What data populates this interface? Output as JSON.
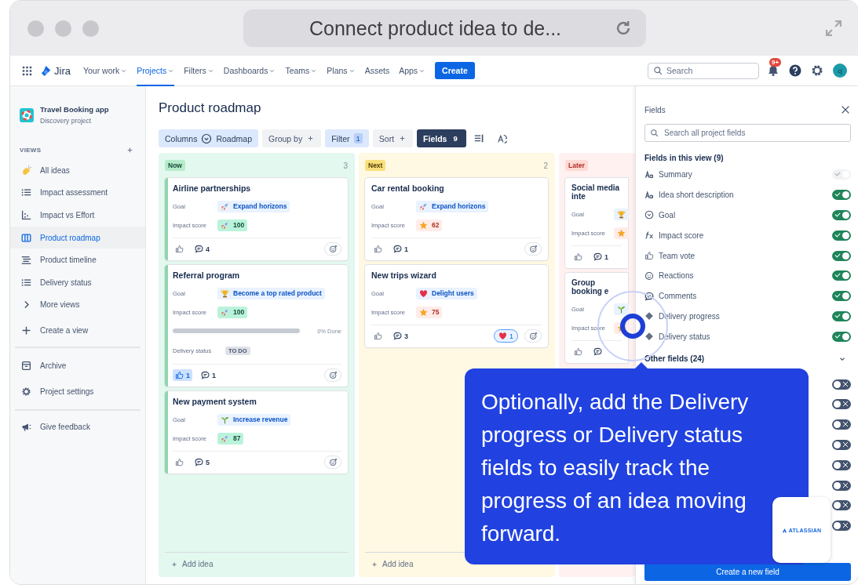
{
  "browser": {
    "address": "Connect product idea to de..."
  },
  "nav": {
    "product": "Jira",
    "items": [
      {
        "label": "Your work",
        "dropdown": true,
        "selected": false
      },
      {
        "label": "Projects",
        "dropdown": true,
        "selected": true
      },
      {
        "label": "Filters",
        "dropdown": true,
        "selected": false
      },
      {
        "label": "Dashboards",
        "dropdown": true,
        "selected": false
      },
      {
        "label": "Teams",
        "dropdown": true,
        "selected": false
      },
      {
        "label": "Plans",
        "dropdown": true,
        "selected": false
      },
      {
        "label": "Assets",
        "dropdown": false,
        "selected": false
      },
      {
        "label": "Apps",
        "dropdown": true,
        "selected": false
      }
    ],
    "create": "Create",
    "search": {
      "placeholder": "Search"
    },
    "notifications": "9+",
    "avatar": "cj"
  },
  "sidebar": {
    "project": {
      "name": "Travel Booking app",
      "type": "Discovery project"
    },
    "views_heading": "VIEWS",
    "views": [
      {
        "label": "All ideas",
        "kind": "wave",
        "selected": false
      },
      {
        "label": "Impact assessment",
        "kind": "list",
        "selected": false
      },
      {
        "label": "Impact vs Effort",
        "kind": "scatter",
        "selected": false
      },
      {
        "label": "Product roadmap",
        "kind": "board",
        "selected": true
      },
      {
        "label": "Product timeline",
        "kind": "timeline",
        "selected": false
      },
      {
        "label": "Delivery status",
        "kind": "list",
        "selected": false
      },
      {
        "label": "More views",
        "kind": "chevron",
        "selected": false
      }
    ],
    "view_actions": [
      {
        "label": "Create a view",
        "kind": "plus"
      }
    ],
    "project_links": [
      {
        "label": "Archive",
        "kind": "archive"
      },
      {
        "label": "Project settings",
        "kind": "gear"
      }
    ],
    "feedback": [
      {
        "label": "Give feedback",
        "kind": "megaphone"
      }
    ]
  },
  "page": {
    "title": "Product roadmap",
    "toolbar": [
      {
        "kind": "columns",
        "label": "Columns",
        "value": "Roadmap",
        "applied": true,
        "selected": false
      },
      {
        "kind": "add",
        "label": "Group by",
        "applied": false,
        "selected": false
      },
      {
        "kind": "count",
        "label": "Filter",
        "count": "1",
        "applied": true,
        "selected": false
      },
      {
        "kind": "add",
        "label": "Sort",
        "applied": false,
        "selected": false
      },
      {
        "kind": "count",
        "label": "Fields",
        "count": "9",
        "applied": false,
        "selected": true
      }
    ],
    "columns": [
      {
        "kind": "now",
        "label": "Now",
        "count": "3",
        "add": "Add idea",
        "cards": [
          {
            "title": "Airline partnerships",
            "goal": {
              "label": "Goal",
              "value": "Expand horizons",
              "kind": "rocket"
            },
            "impact": {
              "label": "Impact score",
              "value": "100",
              "kind": "rocket"
            },
            "votes": {
              "voted": false
            },
            "comments": "4"
          },
          {
            "title": "Referral program",
            "goal": {
              "label": "Goal",
              "value": "Become a top rated product",
              "kind": "trophy"
            },
            "impact": {
              "label": "Impact score",
              "value": "100",
              "kind": "rocket"
            },
            "progress": {
              "level": 0,
              "label": "0% Done"
            },
            "delivery": {
              "label": "Delivery status",
              "value": "TO DO"
            },
            "votes": {
              "voted": true,
              "count": "1"
            },
            "comments": "1"
          },
          {
            "title": "New payment system",
            "goal": {
              "label": "Goal",
              "value": "Increase revenue",
              "kind": "sprout"
            },
            "impact": {
              "label": "Impact score",
              "value": "87",
              "kind": "rocket"
            },
            "votes": {
              "voted": false
            },
            "comments": "5"
          }
        ]
      },
      {
        "kind": "next",
        "label": "Next",
        "count": "2",
        "add": "Add idea",
        "cards": [
          {
            "title": "Car rental booking",
            "goal": {
              "label": "Goal",
              "value": "Expand horizons",
              "kind": "rocket"
            },
            "impact": {
              "label": "Impact score",
              "value": "62",
              "kind": "star"
            },
            "votes": {
              "voted": false
            },
            "comments": "1"
          },
          {
            "title": "New trips wizard",
            "goal": {
              "label": "Goal",
              "value": "Delight users",
              "kind": "heart"
            },
            "impact": {
              "label": "Impact score",
              "value": "75",
              "kind": "star"
            },
            "votes": {
              "voted": false
            },
            "comments": "3",
            "reactions": [
              {
                "kind": "heart",
                "count": "1",
                "selected": true
              }
            ]
          }
        ]
      },
      {
        "kind": "later",
        "label": "Later",
        "cards": [
          {
            "title": "Social media inte",
            "goal": {
              "label": "Goal",
              "kind": "trophy"
            },
            "impact": {
              "label": "Impact score",
              "kind": "star"
            },
            "votes": {
              "voted": false
            },
            "comments": "1"
          },
          {
            "title": "Group booking e",
            "goal": {
              "label": "Goal",
              "kind": "sprout"
            },
            "impact": {
              "label": "Impact score",
              "kind": "star"
            },
            "votes": {
              "voted": false
            }
          }
        ]
      }
    ]
  },
  "fields_panel": {
    "title": "Fields",
    "search": {
      "placeholder": "Search all project fields"
    },
    "in_view": {
      "heading": "Fields in this view (9)",
      "fields": [
        {
          "label": "Summary",
          "kind": "text",
          "on": true,
          "disabled": true
        },
        {
          "label": "Idea short description",
          "kind": "text",
          "on": true,
          "disabled": false
        },
        {
          "label": "Goal",
          "kind": "select",
          "on": true,
          "disabled": false
        },
        {
          "label": "Impact score",
          "kind": "formula",
          "on": true,
          "disabled": false
        },
        {
          "label": "Team vote",
          "kind": "thumb",
          "on": true,
          "disabled": false
        },
        {
          "label": "Reactions",
          "kind": "smiley",
          "on": true,
          "disabled": false
        },
        {
          "label": "Comments",
          "kind": "comment",
          "on": true,
          "disabled": false
        },
        {
          "label": "Delivery progress",
          "kind": "diamond",
          "on": true,
          "disabled": false
        },
        {
          "label": "Delivery status",
          "kind": "diamond",
          "on": true,
          "disabled": false
        }
      ]
    },
    "other": {
      "heading": "Other fields (24)",
      "expanded": true,
      "toggles": [
        {
          "on": false
        },
        {
          "on": false
        },
        {
          "on": false
        },
        {
          "on": false
        },
        {
          "on": false
        },
        {
          "on": false
        },
        {
          "on": false
        },
        {
          "on": false
        }
      ]
    },
    "create": "Create a new field"
  },
  "tooltip": {
    "text": "Optionally, add the Delivery progress or Delivery status fields to easily track the progress of an idea moving forward."
  },
  "badge": {
    "brand": "ATLASSIAN"
  }
}
